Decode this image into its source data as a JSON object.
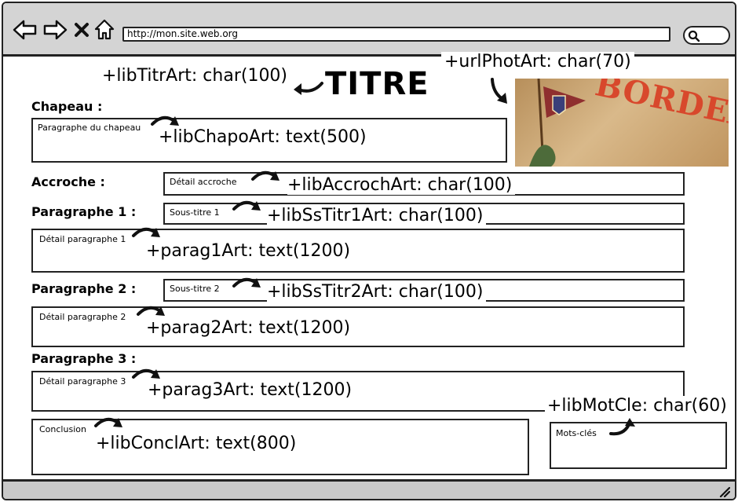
{
  "browser": {
    "url": "http://mon.site.web.org",
    "nav_icons": [
      "back-icon",
      "forward-icon",
      "close-icon",
      "home-icon"
    ],
    "search_icon": "search-icon"
  },
  "title": {
    "text": "TITRE",
    "field": "+libTitrArt: char(100)"
  },
  "photo": {
    "field": "+urlPhotArt: char(70)",
    "image_text": "BORDEAUX"
  },
  "chapeau": {
    "label": "Chapeau :",
    "placeholder": "Paragraphe du chapeau",
    "field": "+libChapoArt: text(500)"
  },
  "accroche": {
    "label": "Accroche :",
    "placeholder": "Détail accroche",
    "field": "+libAccrochArt: char(100)"
  },
  "paragraphe1": {
    "label": "Paragraphe 1 :",
    "subtitle_placeholder": "Sous-titre 1",
    "subtitle_field": "+libSsTitr1Art: char(100)",
    "detail_placeholder": "Détail paragraphe 1",
    "detail_field": "+parag1Art: text(1200)"
  },
  "paragraphe2": {
    "label": "Paragraphe 2 :",
    "subtitle_placeholder": "Sous-titre 2",
    "subtitle_field": "+libSsTitr2Art: char(100)",
    "detail_placeholder": "Détail paragraphe 2",
    "detail_field": "+parag2Art: text(1200)"
  },
  "paragraphe3": {
    "label": "Paragraphe 3 :",
    "detail_placeholder": "Détail paragraphe 3",
    "detail_field": "+parag3Art: text(1200)"
  },
  "conclusion": {
    "placeholder": "Conclusion",
    "field": "+libConclArt: text(800)"
  },
  "motscles": {
    "placeholder": "Mots-clés",
    "field": "+libMotCle: char(60)"
  }
}
